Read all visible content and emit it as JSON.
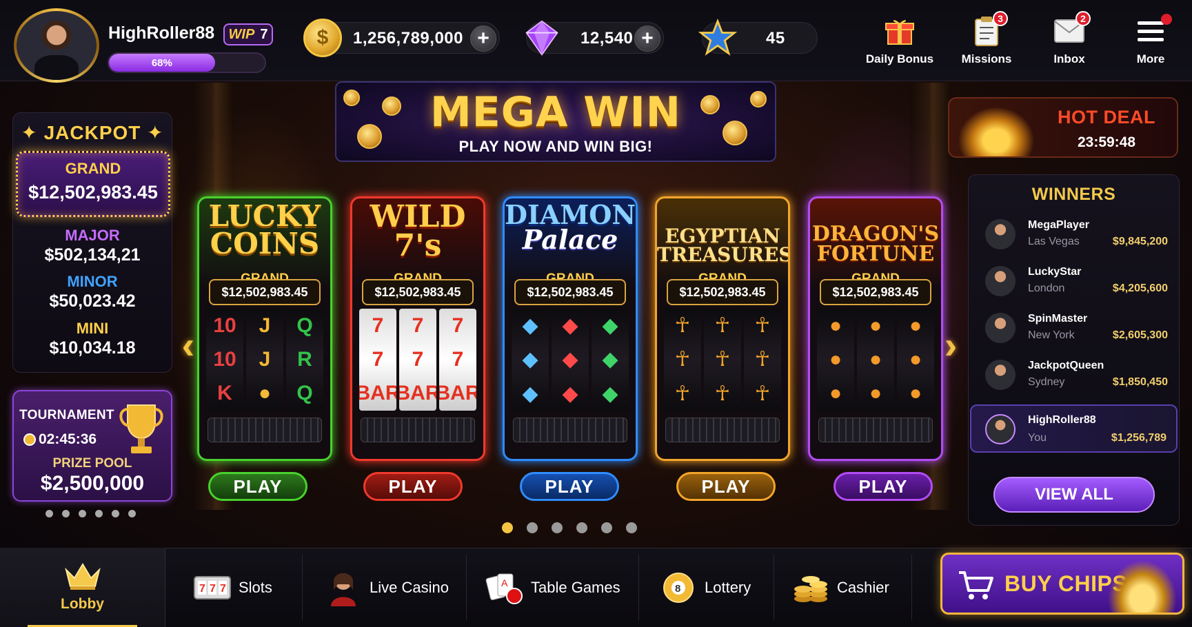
{
  "profile": {
    "username": "HighRoller88",
    "vip_label": "WIP",
    "vip_level": "7",
    "xp_percent": 68,
    "xp_text": "68%"
  },
  "currencies": {
    "coins": "1,256,789,000",
    "gems": "12,540",
    "stars": "45"
  },
  "top_nav": [
    {
      "label": "Daily Bonus",
      "icon": "gift-icon"
    },
    {
      "label": "Missions",
      "icon": "clipboard-icon",
      "badge": "3"
    },
    {
      "label": "Inbox",
      "icon": "mail-icon",
      "badge": "2"
    },
    {
      "label": "More",
      "icon": "menu-icon"
    }
  ],
  "banner": {
    "title": "MEGA WIN",
    "subtitle": "PLAY NOW AND WIN BIG!"
  },
  "jackpot": {
    "title": "✦ JACKPOT ✦",
    "grand": {
      "label": "GRAND",
      "value": "$12,502,983.45"
    },
    "major": {
      "label": "MAJOR",
      "value": "$502,134,21"
    },
    "minor": {
      "label": "MINOR",
      "value": "$50,023.42"
    },
    "mini": {
      "label": "MINI",
      "value": "$10,034.18"
    }
  },
  "tournament": {
    "title": "TOURNAMENT",
    "timer": "02:45:36",
    "prize_label": "PRIZE POOL",
    "prize_value": "$2,500,000"
  },
  "games": [
    {
      "title_line1": "LUCKY",
      "title_line2": "COINS",
      "grand_label": "GRAND",
      "grand_value": "$12,502,983.45",
      "play": "PLAY",
      "accent": "#48d12c",
      "btn_bg": "#1e5a14"
    },
    {
      "title_line1": "WILD",
      "title_line2": "7's",
      "grand_label": "GRAND",
      "grand_value": "$12,502,983.45",
      "play": "PLAY",
      "accent": "#f0392c",
      "btn_bg": "#7a1410"
    },
    {
      "title_line1": "DIAMOND",
      "title_line2": "Palace",
      "grand_label": "GRAND",
      "grand_value": "$12,502,983.45",
      "play": "PLAY",
      "accent": "#2f8cff",
      "btn_bg": "#0f3a86"
    },
    {
      "title_line1": "EGYPTIAN",
      "title_line2": "TREASURES",
      "grand_label": "GRAND",
      "grand_value": "$12,502,983.45",
      "play": "PLAY",
      "accent": "#f3a52a",
      "btn_bg": "#7a4c08"
    },
    {
      "title_line1": "DRAGON'S",
      "title_line2": "FORTUNE",
      "grand_label": "GRAND",
      "grand_value": "$12,502,983.45",
      "play": "PLAY",
      "accent": "#b24cf2",
      "btn_bg": "#4c137a"
    }
  ],
  "hot_deal": {
    "title": "HOT DEAL",
    "timer": "23:59:48"
  },
  "winners": {
    "title": "WINNERS",
    "rows": [
      {
        "name": "MegaPlayer",
        "city": "Las Vegas",
        "amount": "$9,845,200"
      },
      {
        "name": "LuckyStar",
        "city": "London",
        "amount": "$4,205,600"
      },
      {
        "name": "SpinMaster",
        "city": "New York",
        "amount": "$2,605,300"
      },
      {
        "name": "JackpotQueen",
        "city": "Sydney",
        "amount": "$1,850,450"
      },
      {
        "name": "HighRoller88",
        "city": "You",
        "amount": "$1,256,789"
      }
    ],
    "view_all": "VIEW ALL"
  },
  "bottom_nav": {
    "lobby": "Lobby",
    "slots": "Slots",
    "live_casino": "Live Casino",
    "table_games": "Table Games",
    "lottery": "Lottery",
    "cashier": "Cashier",
    "buy_chips": "BUY CHIPS"
  },
  "colors": {
    "gold": "#f4c94c",
    "purple": "#8a2be2",
    "red_badge": "#e01d2b"
  }
}
